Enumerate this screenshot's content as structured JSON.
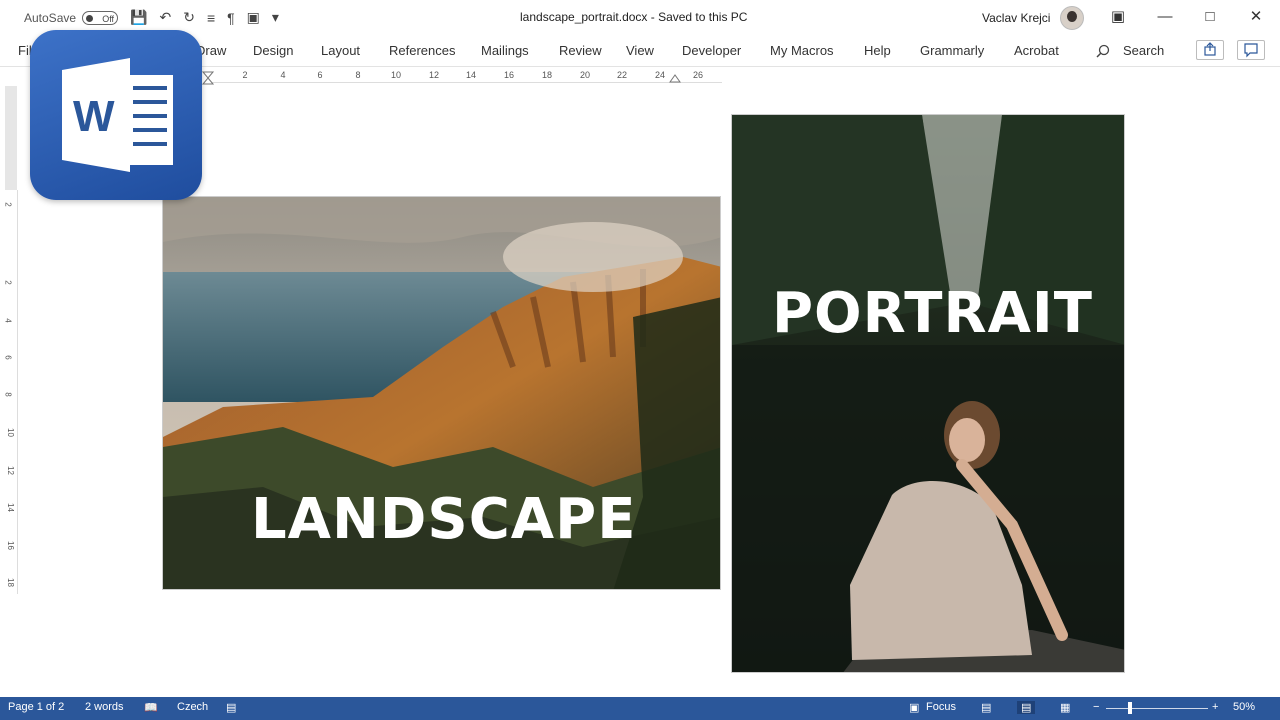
{
  "titlebar": {
    "autosave_label": "AutoSave",
    "autosave_state": "Off",
    "document_title": "landscape_portrait.docx  -  Saved to this PC",
    "user_name": "Vaclav Krejci"
  },
  "ribbon": {
    "tabs": [
      "File",
      "Draw",
      "Design",
      "Layout",
      "References",
      "Mailings",
      "Review",
      "View",
      "Developer",
      "My Macros",
      "Help",
      "Grammarly",
      "Acrobat"
    ],
    "search_label": "Search"
  },
  "ruler": {
    "horizontal": [
      "2",
      "4",
      "6",
      "8",
      "10",
      "12",
      "14",
      "16",
      "18",
      "20",
      "22",
      "24",
      "26"
    ],
    "vertical": [
      "2",
      "2",
      "4",
      "6",
      "8",
      "10",
      "12",
      "14",
      "16",
      "18"
    ]
  },
  "document": {
    "landscape_caption": "LANDSCAPE",
    "portrait_caption": "PORTRAIT"
  },
  "logo": {
    "letter": "W"
  },
  "statusbar": {
    "page": "Page 1 of 2",
    "words": "2 words",
    "language": "Czech",
    "focus": "Focus",
    "zoom": "50%"
  },
  "colors": {
    "statusbar": "#2b579a",
    "word_blue": "#2b579a"
  }
}
